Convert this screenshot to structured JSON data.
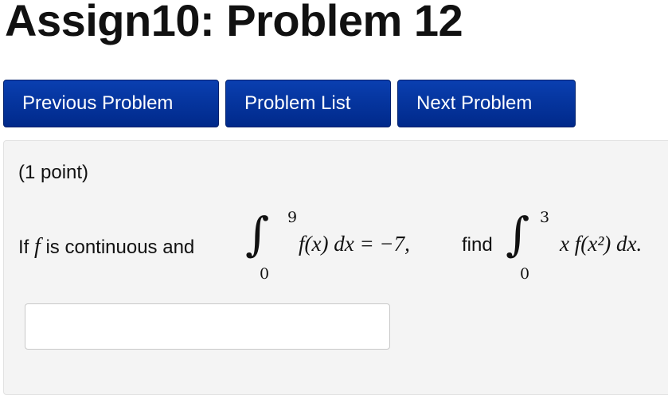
{
  "title": "Assign10: Problem 12",
  "nav": {
    "previous_label": "Previous Problem",
    "list_label": "Problem List",
    "next_label": "Next Problem"
  },
  "problem": {
    "points": "(1 point)",
    "text_if": "If ",
    "f": "f",
    "text_continuous": " is continuous and",
    "integral1": {
      "upper": "9",
      "lower": "0",
      "integrand": "f(x) dx = −7,"
    },
    "text_find": " find",
    "integral2": {
      "upper": "3",
      "lower": "0",
      "integrand": "x f(x²) dx."
    }
  },
  "answer": {
    "value": ""
  }
}
